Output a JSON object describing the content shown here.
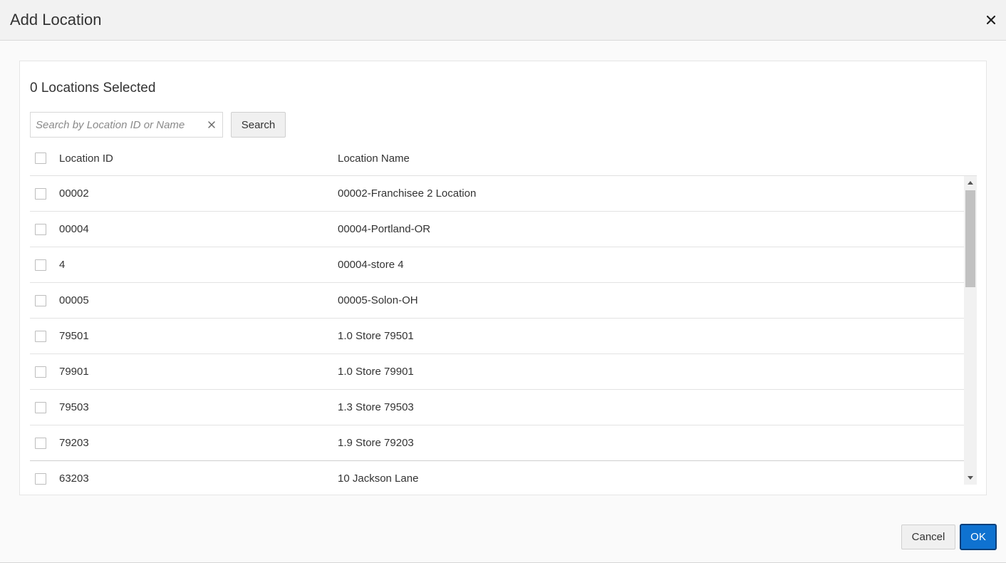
{
  "dialog": {
    "title": "Add Location",
    "close_icon": "close-icon",
    "selected_count": "0 Locations Selected",
    "search": {
      "placeholder": "Search by Location ID or Name",
      "value": "",
      "button_label": "Search"
    },
    "table": {
      "headers": {
        "location_id": "Location ID",
        "location_name": "Location Name"
      },
      "rows": [
        {
          "id": "00002",
          "name": "00002-Franchisee 2 Location"
        },
        {
          "id": "00004",
          "name": "00004-Portland-OR"
        },
        {
          "id": "4",
          "name": "00004-store 4"
        },
        {
          "id": "00005",
          "name": "00005-Solon-OH"
        },
        {
          "id": "79501",
          "name": "1.0 Store 79501"
        },
        {
          "id": "79901",
          "name": "1.0 Store 79901"
        },
        {
          "id": "79503",
          "name": "1.3 Store 79503"
        },
        {
          "id": "79203",
          "name": "1.9 Store 79203"
        },
        {
          "id": "63203",
          "name": "10 Jackson Lane"
        }
      ]
    },
    "footer": {
      "cancel_label": "Cancel",
      "ok_label": "OK"
    },
    "colors": {
      "primary": "#0f72d0",
      "primary_border": "#0a3f7a"
    }
  }
}
